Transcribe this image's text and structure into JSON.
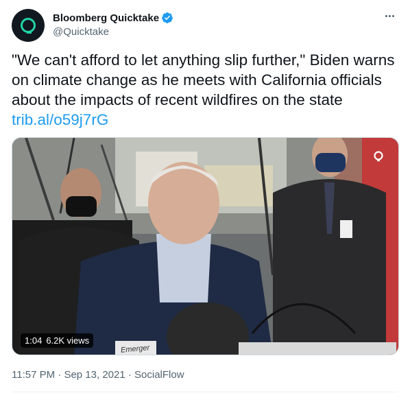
{
  "author": {
    "name": "Bloomberg Quicktake",
    "handle": "@Quicktake",
    "verified": true,
    "avatar_icon": "quicktake-logo-icon",
    "accent": "#22d3a6"
  },
  "tweet": {
    "text": "\"We can't afford to let anything slip further,\" Biden warns on climate change as he meets with California officials about the impacts of recent wildfires on the state",
    "link": "trib.al/o59j7rG"
  },
  "media": {
    "duration": "1:04",
    "views": "6.2K views",
    "caption_fragment": "Emerger",
    "watermark_icon": "quicktake-watermark-icon"
  },
  "meta": {
    "time": "11:57 PM",
    "separator": "·",
    "date": "Sep 13, 2021",
    "source": "SocialFlow"
  },
  "colors": {
    "link": "#1d9bf0",
    "verified": "#1d9bf0",
    "secondary_text": "#536471"
  }
}
